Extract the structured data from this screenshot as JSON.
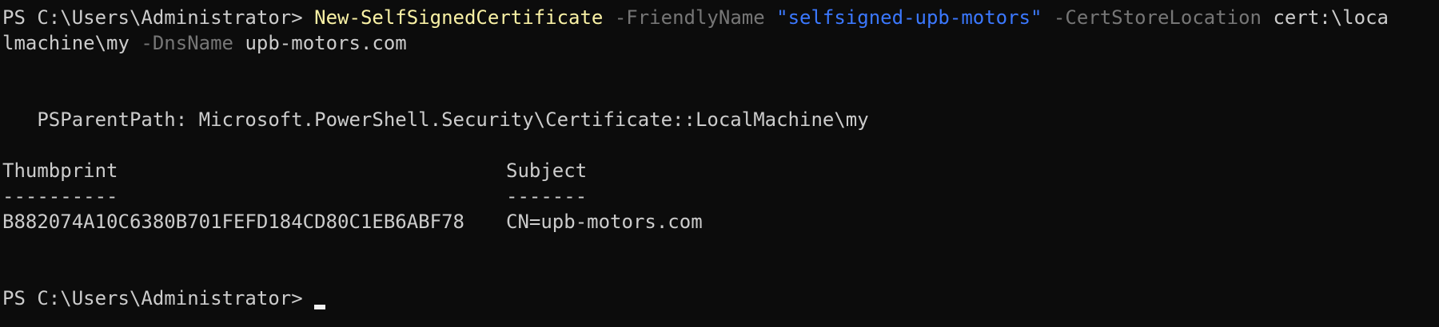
{
  "terminal": {
    "prompt": "PS C:\\Users\\Administrator>",
    "command": {
      "cmdlet": "New-SelfSignedCertificate",
      "p1_name": "-FriendlyName",
      "p1_value": "\"selfsigned-upb-motors\"",
      "p2_name": "-CertStoreLocation",
      "p2_value_part1": "cert:\\loca",
      "p2_value_part2": "lmachine\\my",
      "p3_name": "-DnsName",
      "p3_value": "upb-motors.com"
    },
    "output": {
      "parent_path_line": "   PSParentPath: Microsoft.PowerShell.Security\\Certificate::LocalMachine\\my",
      "headers": [
        "Thumbprint",
        "Subject"
      ],
      "separators": [
        "----------",
        "-------"
      ],
      "rows": [
        [
          "B882074A10C6380B701FEFD184CD80C1EB6ABF78",
          "CN=upb-motors.com"
        ]
      ]
    }
  },
  "colors": {
    "background": "#0c0c0c",
    "foreground": "#cccccc",
    "cmdlet": "#f9f1a5",
    "parameter": "#767676",
    "string": "#3b78ff"
  }
}
